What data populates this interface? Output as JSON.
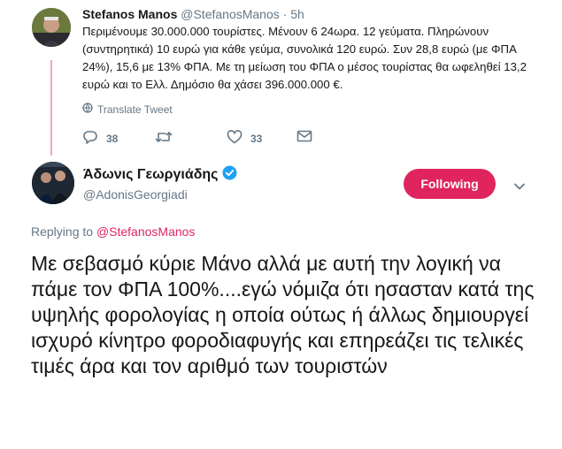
{
  "tweet1": {
    "author_name": "Stefanos Manos",
    "handle": "@StefanosManos",
    "separator": "·",
    "time": "5h",
    "text": "Περιμένουμε 30.000.000 τουρίστες. Μένουν 6 24ωρα. 12 γεύματα. Πληρώνουν (συντηρητικά) 10 ευρώ για κάθε γεύμα, συνολικά 120 ευρώ. Συν 28,8 ευρώ (με ΦΠΑ 24%), 15,6 με 13% ΦΠΑ. Με τη μείωση του ΦΠΑ ο μέσος τουρίστας θα ωφεληθεί 13,2 ευρώ και το Ελλ. Δημόσιο θα χάσει 396.000.000 €.",
    "translate_label": "Translate Tweet",
    "replies": "38",
    "retweets": "",
    "likes": "33"
  },
  "tweet2": {
    "author_name": "Άδωνις Γεωργιάδης",
    "handle": "@AdonisGeorgiadi",
    "follow_label": "Following",
    "replying_prefix": "Replying to",
    "replying_to": "@StefanosManos",
    "text": "Με σεβασμό κύριε Μάνο αλλά με αυτή την λογική να πάμε τον ΦΠΑ 100%....εγώ νόμιζα ότι ησασταν κατά της υψηλής φορολογίας η οποία ούτως ή άλλως δημιουργεί ισχυρό κίνητρο φοροδιαφυγής και επηρεάζει τις τελικές τιμές άρα και τον αριθμό των τουριστών"
  },
  "colors": {
    "follow_button": "#e0245e",
    "mention": "#e0245e",
    "thread_line": "#f3a6b2",
    "verified": "#1da1f2",
    "muted_text": "#657786"
  },
  "icons": [
    "reply-icon",
    "retweet-icon",
    "like-icon",
    "direct-message-icon",
    "globe-icon",
    "verified-badge-icon",
    "chevron-down-icon"
  ]
}
